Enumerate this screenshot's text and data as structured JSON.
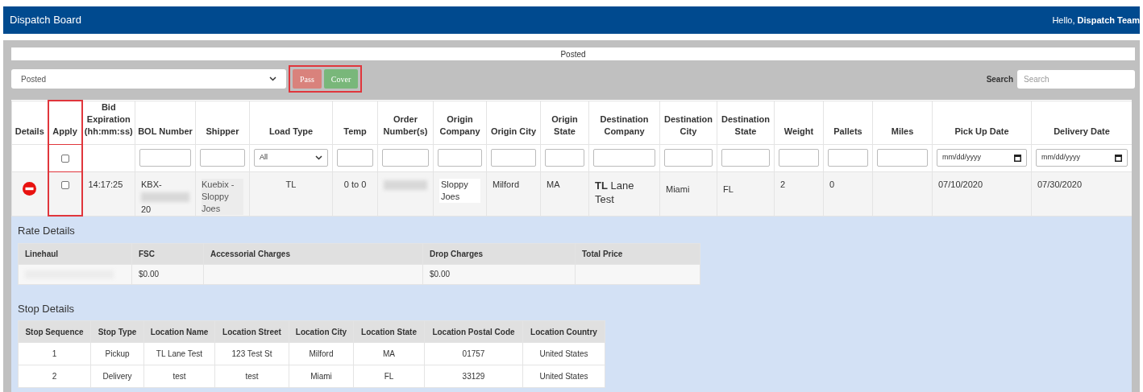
{
  "header": {
    "title": "Dispatch Board",
    "greeting": "Hello, **Dispatch Team**"
  },
  "status_strip": "Posted",
  "toolbar": {
    "status_select": "Posted",
    "actions_highlighted": true,
    "buttons": [
      {
        "label": "Pass",
        "kind": "danger"
      },
      {
        "label": "Cover",
        "kind": "success"
      }
    ],
    "search_label": "Search",
    "search_placeholder": "Search"
  },
  "table": {
    "columns": [
      {
        "label": "Details",
        "highlighted": false
      },
      {
        "label": "Apply",
        "filter": {
          "kind": "checkbox",
          "checked": false
        },
        "highlighted": true
      },
      {
        "label": "Bid Expiration (hh:mm:ss)",
        "highlighted": false
      },
      {
        "label": "BOL Number",
        "filter": {
          "kind": "text"
        },
        "highlighted": false
      },
      {
        "label": "Shipper",
        "filter": {
          "kind": "text"
        },
        "highlighted": false
      },
      {
        "label": "Load Type",
        "filter": {
          "kind": "select",
          "value": "All"
        },
        "highlighted": false
      },
      {
        "label": "Temp",
        "filter": {
          "kind": "text"
        },
        "highlighted": false
      },
      {
        "label": "Order Number(s)",
        "filter": {
          "kind": "text"
        },
        "highlighted": false
      },
      {
        "label": "Origin Company",
        "filter": {
          "kind": "text"
        },
        "highlighted": false
      },
      {
        "label": "Origin City",
        "filter": {
          "kind": "text"
        },
        "highlighted": false
      },
      {
        "label": "Origin State",
        "filter": {
          "kind": "text"
        },
        "highlighted": false
      },
      {
        "label": "Destination Company",
        "filter": {
          "kind": "text"
        },
        "highlighted": false
      },
      {
        "label": "Destination City",
        "filter": {
          "kind": "text"
        },
        "highlighted": false
      },
      {
        "label": "Destination State",
        "filter": {
          "kind": "text"
        },
        "highlighted": false
      },
      {
        "label": "Weight",
        "filter": {
          "kind": "text"
        },
        "highlighted": false
      },
      {
        "label": "Pallets",
        "filter": {
          "kind": "text"
        },
        "highlighted": false
      },
      {
        "label": "Miles",
        "filter": {
          "kind": "text"
        },
        "highlighted": false
      },
      {
        "label": "Pick Up Date",
        "filter": {
          "kind": "date",
          "value": "mm/dd/yyyy"
        },
        "highlighted": false
      },
      {
        "label": "Delivery Date",
        "filter": {
          "kind": "date",
          "value": "mm/dd/yyyy"
        },
        "highlighted": false
      }
    ],
    "rows": [
      {
        "expanded": true,
        "apply_checked": false,
        "cells": [
          {
            "kind": "icon"
          },
          {
            "kind": "checkbox"
          },
          {
            "kind": "text",
            "text": "14:17:25"
          },
          {
            "kind": "redacted",
            "before": "KBX-",
            "after": "20"
          },
          {
            "kind": "shaded",
            "text": "Kuebix - Sloppy Joes"
          },
          {
            "kind": "center",
            "text": "TL"
          },
          {
            "kind": "center",
            "text": "0 to 0"
          },
          {
            "kind": "redacted"
          },
          {
            "kind": "boxed",
            "text": "Sloppy Joes"
          },
          {
            "kind": "text",
            "text": "Milford"
          },
          {
            "kind": "text",
            "text": "MA"
          },
          {
            "kind": "large",
            "text": "**TL** Lane Test"
          },
          {
            "kind": "middle",
            "text": "Miami"
          },
          {
            "kind": "middle",
            "text": "FL"
          },
          {
            "kind": "text",
            "text": "2"
          },
          {
            "kind": "text",
            "text": "0"
          },
          {
            "kind": "text"
          },
          {
            "kind": "text",
            "text": "07/10/2020"
          },
          {
            "kind": "text",
            "text": "07/30/2020"
          }
        ]
      }
    ]
  },
  "rate_details": {
    "title": "Rate Details",
    "columns": [
      "Linehaul",
      "FSC",
      "Accessorial Charges",
      "Drop Charges",
      "Total Price"
    ],
    "row": [
      {
        "kind": "redacted"
      },
      {
        "kind": "text",
        "text": "$0.00"
      },
      {
        "kind": "text"
      },
      {
        "kind": "text",
        "text": "$0.00"
      },
      {
        "kind": "text"
      }
    ]
  },
  "stop_details": {
    "title": "Stop Details",
    "columns": [
      "Stop Sequence",
      "Stop Type",
      "Location Name",
      "Location Street",
      "Location City",
      "Location State",
      "Location Postal Code",
      "Location Country"
    ],
    "rows": [
      [
        "1",
        "Pickup",
        "TL Lane Test",
        "123 Test St",
        "Milford",
        "MA",
        "01757",
        "United States"
      ],
      [
        "2",
        "Delivery",
        "test",
        "test",
        "Miami",
        "FL",
        "33129",
        "United States"
      ]
    ]
  }
}
